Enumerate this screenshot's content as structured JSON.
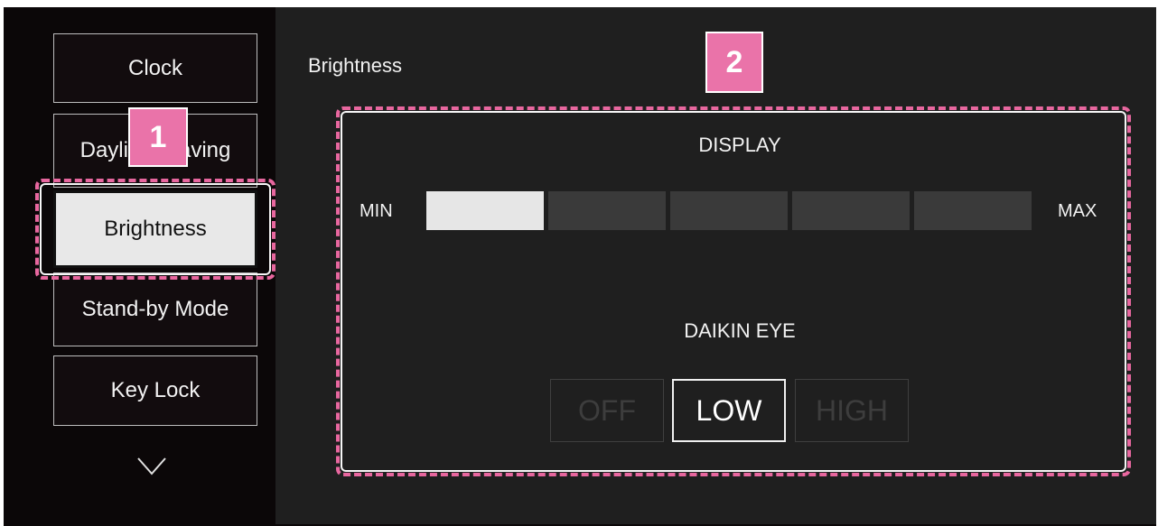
{
  "sidebar": {
    "items": [
      {
        "label": "Clock"
      },
      {
        "label": "Daylight Saving"
      },
      {
        "label": "Brightness"
      },
      {
        "label": "Stand-by Mode"
      },
      {
        "label": "Key Lock"
      }
    ],
    "selected_index": 2,
    "more_icon": "chevron-down-icon"
  },
  "panel": {
    "title": "Brightness",
    "display": {
      "title": "DISPLAY",
      "min_label": "MIN",
      "max_label": "MAX",
      "levels_total": 5,
      "level": 1
    },
    "daikin_eye": {
      "title": "DAIKIN EYE",
      "options": [
        {
          "label": "OFF"
        },
        {
          "label": "LOW"
        },
        {
          "label": "HIGH"
        }
      ],
      "selected_index": 1
    }
  },
  "callouts": {
    "one": "1",
    "two": "2"
  },
  "colors": {
    "accent_pink": "#ea73a9",
    "screen_bg": "#0b0708",
    "panel_bg": "#1f1f1f",
    "selected_bg": "#e8e8e8"
  }
}
